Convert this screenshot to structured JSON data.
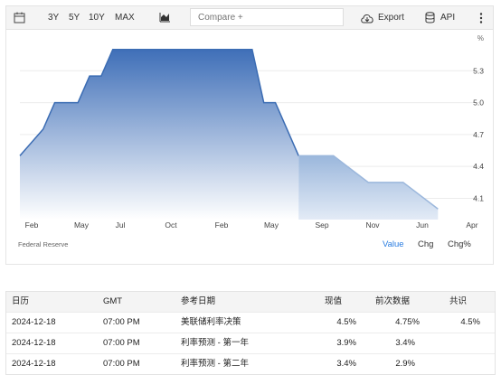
{
  "toolbar": {
    "range_buttons": [
      "3Y",
      "5Y",
      "10Y",
      "MAX"
    ],
    "compare_placeholder": "Compare +",
    "export_label": "Export",
    "api_label": "API"
  },
  "chart_data": {
    "type": "area",
    "unit_label": "%",
    "y_ticks": [
      5.3,
      5.0,
      4.7,
      4.4,
      4.1
    ],
    "ylim": [
      3.9,
      5.6
    ],
    "x_tick_labels": [
      "Feb",
      "May",
      "Jul",
      "Oct",
      "Feb",
      "May",
      "Sep",
      "Nov",
      "Jun",
      "Apr"
    ],
    "series": [
      {
        "points": [
          {
            "x": "2022-12",
            "y": 4.5
          },
          {
            "x": "2023-02",
            "y": 4.75
          },
          {
            "x": "2023-03",
            "y": 5.0
          },
          {
            "x": "2023-05",
            "y": 5.0
          },
          {
            "x": "2023-06",
            "y": 5.25
          },
          {
            "x": "2023-07",
            "y": 5.25
          },
          {
            "x": "2023-08",
            "y": 5.5
          },
          {
            "x": "2024-08",
            "y": 5.5
          },
          {
            "x": "2024-09",
            "y": 5.0
          },
          {
            "x": "2024-10",
            "y": 5.0
          },
          {
            "x": "2024-12",
            "y": 4.5
          }
        ]
      },
      {
        "forecast": true,
        "points": [
          {
            "x": "2024-12",
            "y": 4.5
          },
          {
            "x": "2025-03",
            "y": 4.5
          },
          {
            "x": "2025-06",
            "y": 4.25
          },
          {
            "x": "2025-09",
            "y": 4.25
          },
          {
            "x": "2025-12",
            "y": 4.0
          }
        ]
      }
    ],
    "grid": true
  },
  "chart_footer": {
    "source": "Federal Reserve",
    "switches": [
      "Value",
      "Chg",
      "Chg%"
    ],
    "active_switch": "Value"
  },
  "calendar": {
    "headers": {
      "date": "日历",
      "time": "GMT",
      "reference": "参考日期",
      "actual": "现值",
      "previous": "前次数据",
      "consensus": "共识"
    },
    "rows": [
      {
        "date": "2024-12-18",
        "time": "07:00 PM",
        "reference": "美联储利率决策",
        "actual": "4.5%",
        "previous": "4.75%",
        "consensus": "4.5%"
      },
      {
        "date": "2024-12-18",
        "time": "07:00 PM",
        "reference": "利率预测 - 第一年",
        "actual": "3.9%",
        "previous": "3.4%",
        "consensus": ""
      },
      {
        "date": "2024-12-18",
        "time": "07:00 PM",
        "reference": "利率预测 - 第二年",
        "actual": "3.4%",
        "previous": "2.9%",
        "consensus": ""
      }
    ]
  },
  "colors": {
    "accent": "#2a7de1",
    "series": "#3b6cb3",
    "forecast": "#9bb7dc"
  }
}
